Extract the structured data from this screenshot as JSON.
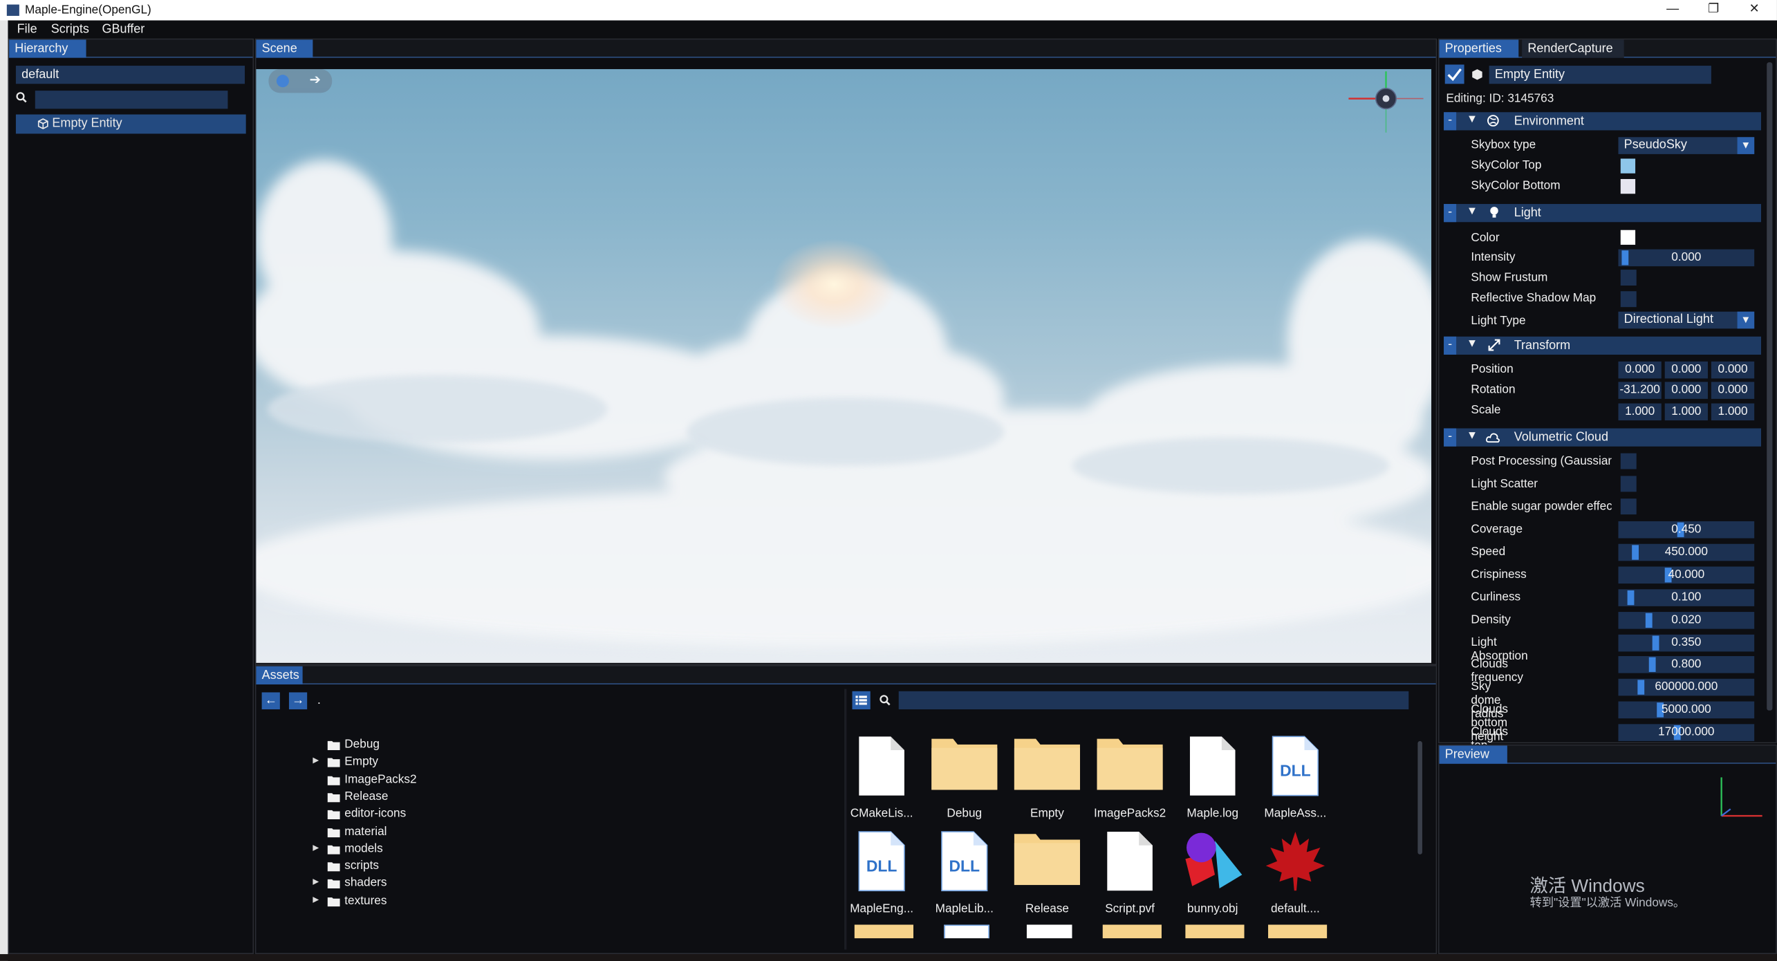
{
  "window": {
    "title": "Maple-Engine(OpenGL)",
    "minimize": "—",
    "restore": "❐",
    "close": "✕"
  },
  "menu": [
    "File",
    "Scripts",
    "GBuffer"
  ],
  "hierarchy": {
    "tab": "Hierarchy",
    "scene_name": "default",
    "search_placeholder": "",
    "items": [
      {
        "label": "Empty Entity"
      }
    ]
  },
  "scene": {
    "tab": "Scene"
  },
  "assets": {
    "tab": "Assets",
    "path": ".",
    "tree": [
      {
        "label": "Debug",
        "expandable": false
      },
      {
        "label": "Empty",
        "expandable": true
      },
      {
        "label": "ImagePacks2",
        "expandable": false
      },
      {
        "label": "Release",
        "expandable": false
      },
      {
        "label": "editor-icons",
        "expandable": false
      },
      {
        "label": "material",
        "expandable": false
      },
      {
        "label": "models",
        "expandable": true
      },
      {
        "label": "scripts",
        "expandable": false
      },
      {
        "label": "shaders",
        "expandable": true
      },
      {
        "label": "textures",
        "expandable": true
      }
    ],
    "grid": [
      {
        "label": "CMakeLis...",
        "kind": "file"
      },
      {
        "label": "Debug",
        "kind": "folder"
      },
      {
        "label": "Empty",
        "kind": "folder"
      },
      {
        "label": "ImagePacks2",
        "kind": "folder"
      },
      {
        "label": "Maple.log",
        "kind": "file"
      },
      {
        "label": "MapleAss...",
        "kind": "dll"
      },
      {
        "label": "MapleEng...",
        "kind": "dll"
      },
      {
        "label": "MapleLib...",
        "kind": "dll"
      },
      {
        "label": "Release",
        "kind": "folder"
      },
      {
        "label": "Script.pvf",
        "kind": "file"
      },
      {
        "label": "bunny.obj",
        "kind": "model"
      },
      {
        "label": "default....",
        "kind": "maple"
      }
    ],
    "dll_text": "DLL"
  },
  "properties": {
    "tabs": [
      "Properties",
      "RenderCapture"
    ],
    "entity_name": "Empty Entity",
    "editing": "Editing:  ID: 3145763",
    "environment": {
      "title": "Environment",
      "skybox_label": "Skybox type",
      "skybox_value": "PseudoSky",
      "skytop_label": "SkyColor Top",
      "skybottom_label": "SkyColor Bottom",
      "skytop_color": "#8ec6ea",
      "skybottom_color": "#e6e6f0"
    },
    "light": {
      "title": "Light",
      "color_label": "Color",
      "intensity_label": "Intensity",
      "intensity": "0.000",
      "frustum_label": "Show Frustum",
      "rsm_label": "Reflective Shadow Map",
      "type_label": "Light Type",
      "type_value": "Directional Light"
    },
    "transform": {
      "title": "Transform",
      "position_label": "Position",
      "rotation_label": "Rotation",
      "scale_label": "Scale",
      "position": [
        "0.000",
        "0.000",
        "0.000"
      ],
      "rotation": [
        "-31.200",
        "0.000",
        "0.000"
      ],
      "scale": [
        "1.000",
        "1.000",
        "1.000"
      ]
    },
    "cloud": {
      "title": "Volumetric Cloud",
      "post_label": "Post Processing (Gaussiar",
      "scatter_label": "Light Scatter",
      "sugar_label": "Enable sugar powder effec",
      "sliders": [
        {
          "label": "Coverage",
          "value": "0.450",
          "fill": 0.45
        },
        {
          "label": "Speed",
          "value": "450.000",
          "fill": 0.09
        },
        {
          "label": "Crispiness",
          "value": "40.000",
          "fill": 0.35
        },
        {
          "label": "Curliness",
          "value": "0.100",
          "fill": 0.05
        },
        {
          "label": "Density",
          "value": "0.020",
          "fill": 0.2
        },
        {
          "label": "Light Absorption",
          "value": "0.350",
          "fill": 0.25
        },
        {
          "label": "Clouds frequency",
          "value": "0.800",
          "fill": 0.22
        },
        {
          "label": "Sky dome radius",
          "value": "600000.000",
          "fill": 0.13
        },
        {
          "label": "Clouds bottom height",
          "value": "5000.000",
          "fill": 0.29
        },
        {
          "label": "Clouds top height",
          "value": "17000.000",
          "fill": 0.42
        }
      ]
    }
  },
  "preview": {
    "tab": "Preview"
  },
  "watermark": {
    "line1": "激活 Windows",
    "line2": "转到\"设置\"以激活 Windows。"
  }
}
